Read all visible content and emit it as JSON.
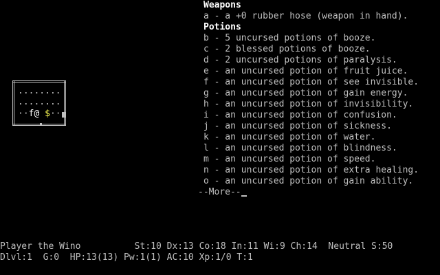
{
  "inventory": {
    "sections": [
      {
        "header": "Weapons",
        "items": [
          "a - a +0 rubber hose (weapon in hand)."
        ]
      },
      {
        "header": "Potions",
        "items": [
          "b - 5 uncursed potions of booze.",
          "c - 2 blessed potions of booze.",
          "d - 2 uncursed potions of paralysis.",
          "e - an uncursed potion of fruit juice.",
          "f - an uncursed potion of see invisible.",
          "g - an uncursed potion of gain energy.",
          "h - an uncursed potion of invisibility.",
          "i - an uncursed potion of confusion.",
          "j - an uncursed potion of sickness.",
          "k - an uncursed potion of water.",
          "l - an uncursed potion of blindness.",
          "m - an uncursed potion of speed.",
          "n - an uncursed potion of extra healing.",
          "o - an uncursed potion of gain ability."
        ]
      }
    ],
    "more_prompt": "--More--"
  },
  "map": {
    "floor_row": "........",
    "row3_left": "··",
    "pet_glyph": "f",
    "hero_glyph": "@",
    "gold_glyph": "$",
    "row3_right": "··",
    "colors": {
      "gold": "#ffff55",
      "hero": "#ffffff",
      "walls": "#c0c0c0"
    }
  },
  "status": {
    "line1": "Player the Wino          St:10 Dx:13 Co:18 In:11 Wi:9 Ch:14  Neutral S:50",
    "line2": "Dlvl:1  G:0  HP:13(13) Pw:1(1) AC:10 Xp:1/0 T:1"
  }
}
